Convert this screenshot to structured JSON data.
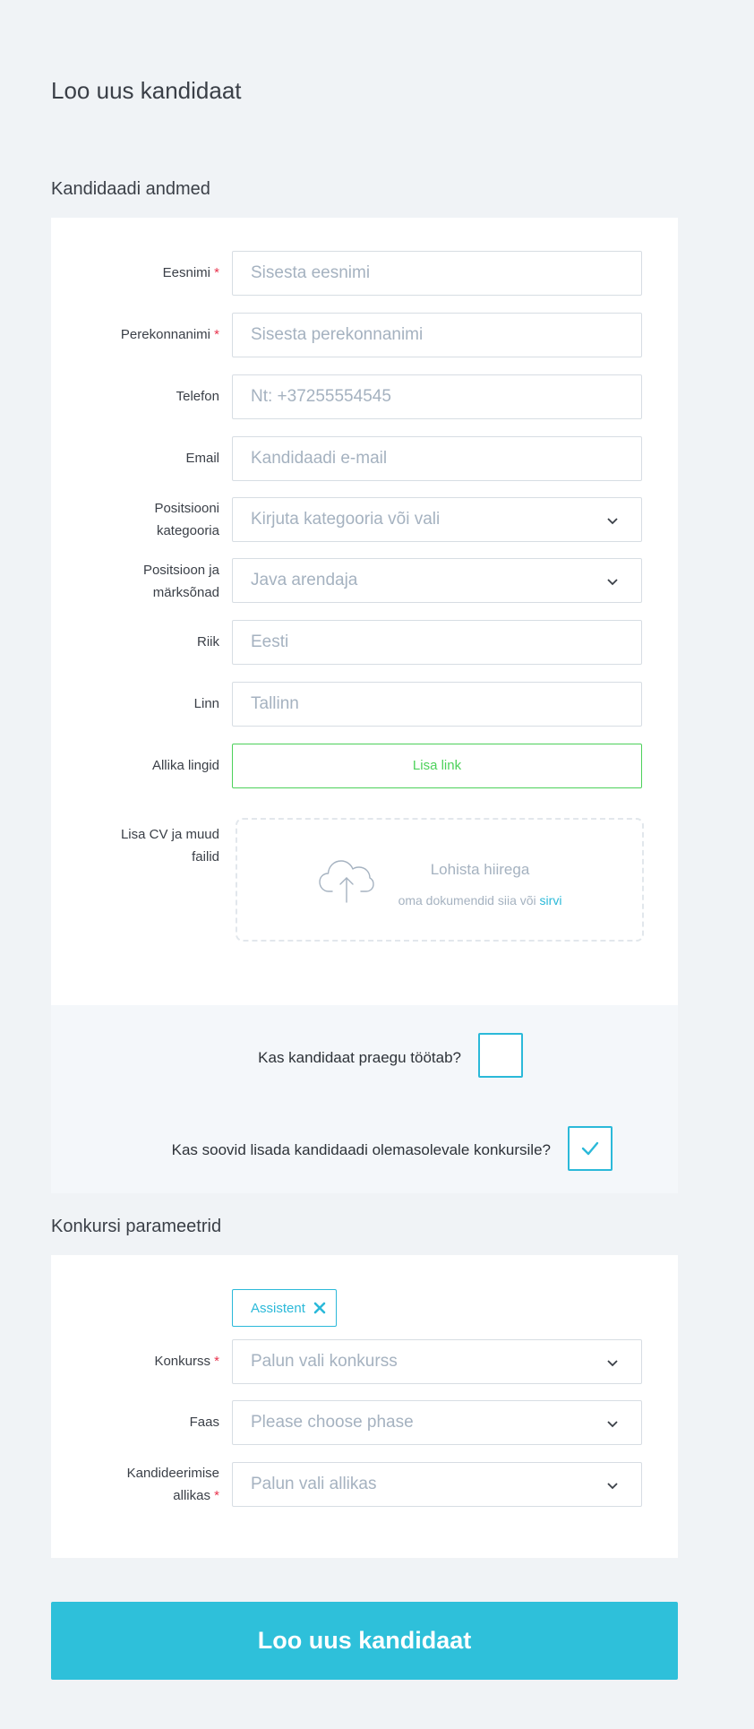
{
  "page": {
    "title": "Loo uus kandidaat"
  },
  "candidate_section": {
    "title": "Kandidaadi andmed",
    "fields": {
      "first_name": {
        "label": "Eesnimi",
        "required": "*",
        "placeholder": "Sisesta eesnimi"
      },
      "last_name": {
        "label": "Perekonnanimi",
        "required": "*",
        "placeholder": "Sisesta perekonnanimi"
      },
      "phone": {
        "label": "Telefon",
        "placeholder": "Nt: +37255554545"
      },
      "email": {
        "label": "Email",
        "placeholder": "Kandidaadi e-mail"
      },
      "category": {
        "label_line1": "Positsiooni",
        "label_line2": "kategooria",
        "placeholder": "Kirjuta kategooria või vali"
      },
      "position": {
        "label_line1": "Positsioon ja",
        "label_line2": "märksõnad",
        "placeholder": "Java arendaja"
      },
      "country": {
        "label": "Riik",
        "placeholder": "Eesti"
      },
      "city": {
        "label": "Linn",
        "placeholder": "Tallinn"
      },
      "source_links": {
        "label": "Allika lingid",
        "button": "Lisa link"
      },
      "files": {
        "label_line1": "Lisa CV ja muud",
        "label_line2": "failid",
        "dropzone_title": "Lohista hiirega",
        "dropzone_sub": "oma dokumendid siia või",
        "dropzone_browse": "sirvi"
      }
    }
  },
  "questions": {
    "currently_working": {
      "text": "Kas kandidaat praegu töötab?",
      "checked": false
    },
    "add_to_competition": {
      "text": "Kas soovid lisada kandidaadi olemasolevale konkursile?",
      "checked": true
    }
  },
  "competition_section": {
    "title": "Konkursi parameetrid",
    "tag": {
      "label": "Assistent"
    },
    "fields": {
      "competition": {
        "label": "Konkurss",
        "required": "*",
        "placeholder": "Palun vali konkurss"
      },
      "phase": {
        "label": "Faas",
        "placeholder": "Please choose phase"
      },
      "source": {
        "label_line1": "Kandideerimise",
        "label_line2": "allikas",
        "required": "*",
        "placeholder": "Palun vali allikas"
      }
    }
  },
  "submit": {
    "label": "Loo uus kandidaat"
  },
  "colors": {
    "accent": "#2bb9d9",
    "primary_button": "#2ec0da",
    "success": "#4cd15a",
    "required": "#e8344e",
    "placeholder": "#a5b2c0",
    "background": "#f0f3f6"
  }
}
